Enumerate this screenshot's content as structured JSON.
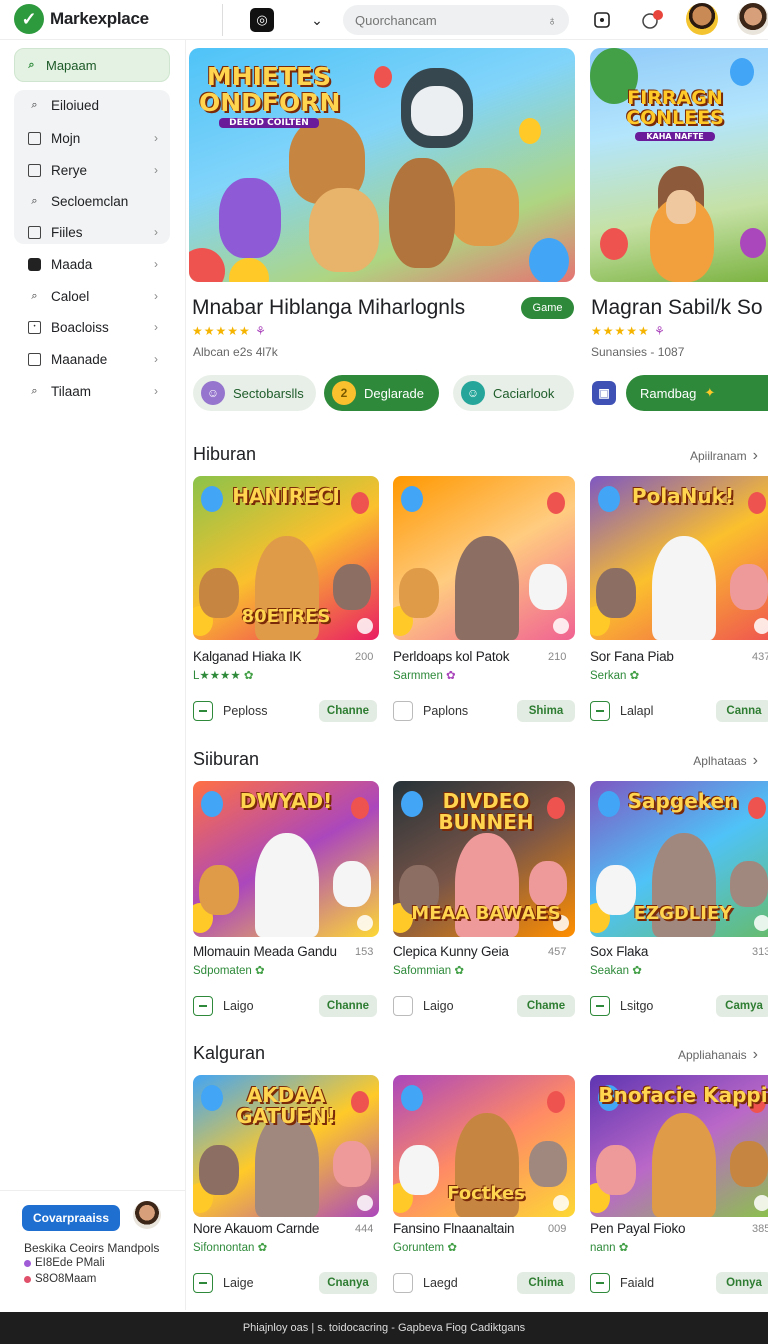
{
  "brand": {
    "name": "Markexplace"
  },
  "search": {
    "placeholder": "Quorchancam"
  },
  "sidebar": {
    "top": "Mapaam",
    "items": [
      {
        "label": "Eiloiued",
        "icon": "search-icon"
      },
      {
        "label": "Mojn",
        "icon": "box-icon"
      },
      {
        "label": "Rerye",
        "icon": "box-icon"
      },
      {
        "label": "Secloemclan",
        "icon": "search-icon"
      },
      {
        "label": "Fiiles",
        "icon": "box-icon"
      },
      {
        "label": "Maada",
        "icon": "filled-square-icon"
      },
      {
        "label": "Caloel",
        "icon": "search-icon"
      },
      {
        "label": "Boacloiss",
        "icon": "dot-square-icon"
      },
      {
        "label": "Maanade",
        "icon": "box-icon"
      },
      {
        "label": "Tilaam",
        "icon": "search-icon"
      }
    ],
    "cta": "Covarpraaiss",
    "note_title": "Beskika Ceoirs Mandpols",
    "note_items": [
      {
        "label": "EI8Ede PMali",
        "color": "#a05bd6"
      },
      {
        "label": "S8O8Maam",
        "color": "#e0506a"
      }
    ]
  },
  "hero": {
    "cards": [
      {
        "art_title": "MHIETES ONDFORN",
        "art_sub": "DEEOD COILTEN",
        "title": "Mnabar Hiblanga Miharlognls",
        "badge": "Game",
        "rating": 4.5,
        "meta": "Albcan e2s 4l7k"
      },
      {
        "art_title": "FIRRAGN CONLEES",
        "art_sub": "KAHA NAFTE",
        "title": "Magran Sabil/k So",
        "rating": 4.5,
        "meta": "Sunansies - 1087"
      }
    ],
    "chips": [
      {
        "label": "Sectobarslls",
        "style": "light"
      },
      {
        "label": "Deglarade",
        "style": "green"
      },
      {
        "label": "Caciarlook",
        "style": "light"
      },
      {
        "label": "Ramdbag",
        "style": "green"
      }
    ]
  },
  "sections": [
    {
      "title": "Hiburan",
      "link": "Apiilranam",
      "cards": [
        {
          "art": "HANIRECI",
          "art2": "80ETRES",
          "title": "Kalganad Hiaka IK",
          "count": "200",
          "sub": "L★★★★",
          "action": "Peploss",
          "button": "Channe"
        },
        {
          "art": "",
          "art2": "",
          "title": "Perldoaps kol Patok",
          "count": "210",
          "sub": "Sarmmen",
          "action": "Paplons",
          "button": "Shima"
        },
        {
          "art": "PolaNuk!",
          "art2": "",
          "title": "Sor Fana Piab",
          "count": "437",
          "sub": "Serkan",
          "action": "Lalapl",
          "button": "Canna"
        }
      ]
    },
    {
      "title": "Siiburan",
      "link": "Aplhataas",
      "cards": [
        {
          "art": "DWYAD!",
          "art2": "",
          "title": "Mlomauin Meada Gandu",
          "count": "153",
          "sub": "Sdpomaten",
          "action": "Laigo",
          "button": "Channe"
        },
        {
          "art": "DIVDEO BUNNEH",
          "art2": "MEAA BAWAES",
          "title": "Clepica Kunny Geia",
          "count": "457",
          "sub": "Safommian",
          "action": "Laigo",
          "button": "Chame"
        },
        {
          "art": "Sapgeken",
          "art2": "EZGDLIEY",
          "title": "Sox Flaka",
          "count": "313",
          "sub": "Seakan",
          "action": "Lsitgo",
          "button": "Camya"
        }
      ]
    },
    {
      "title": "Kalguran",
      "link": "Appliahanais",
      "cards": [
        {
          "art": "AKDAA GATUEN!",
          "art2": "",
          "title": "Nore Akauom Carnde",
          "count": "444",
          "sub": "Sifonnontan",
          "action": "Laige",
          "button": "Cnanya"
        },
        {
          "art": "",
          "art2": "Foctkes",
          "title": "Fansino Flnaanaltain",
          "count": "009",
          "sub": "Goruntem",
          "action": "Laegd",
          "button": "Chima"
        },
        {
          "art": "Bnofacie Kappi",
          "art2": "",
          "title": "Pen Payal Fioko",
          "count": "385",
          "sub": "nann",
          "action": "Faiald",
          "button": "Onnya"
        }
      ]
    }
  ],
  "footer": {
    "text": "Phiajnloy oas  |  s. toidocacring -  Gapbeva Fiog Cadiktgans"
  }
}
